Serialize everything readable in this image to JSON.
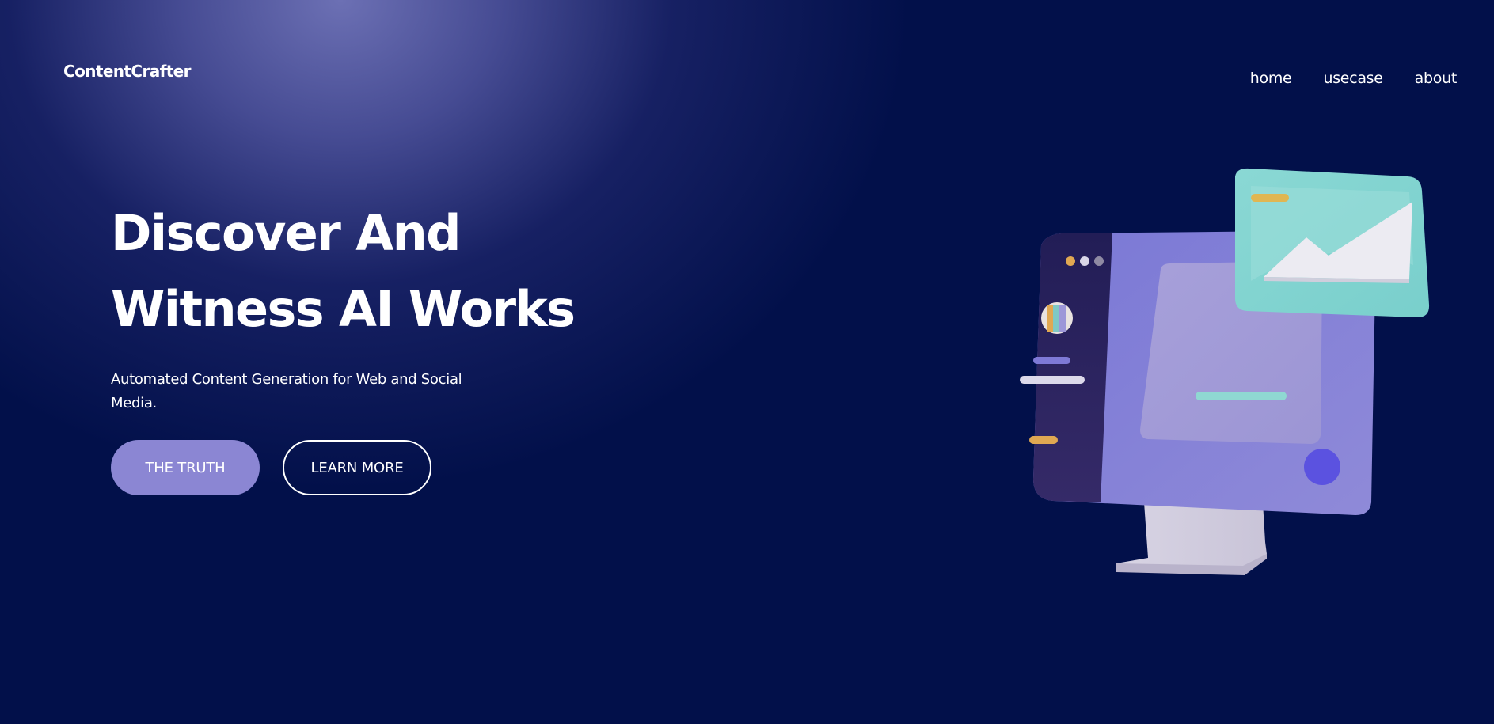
{
  "brand": {
    "name": "ContentCrafter"
  },
  "nav": {
    "items": [
      {
        "label": "home"
      },
      {
        "label": "usecase"
      },
      {
        "label": "about"
      }
    ]
  },
  "hero": {
    "title_line1": "Discover And",
    "title_line2": "Witness AI Works",
    "subtitle": "Automated Content Generation for Web and Social Media.",
    "primary_button": "THE TRUTH",
    "secondary_button": "LEARN MORE"
  },
  "colors": {
    "background": "#02104a",
    "glow": "#6c70b4",
    "primary_button": "#8b86d3",
    "text": "#ffffff"
  },
  "icons": {
    "illustration": "computer-monitor-with-image-card-illustration"
  }
}
